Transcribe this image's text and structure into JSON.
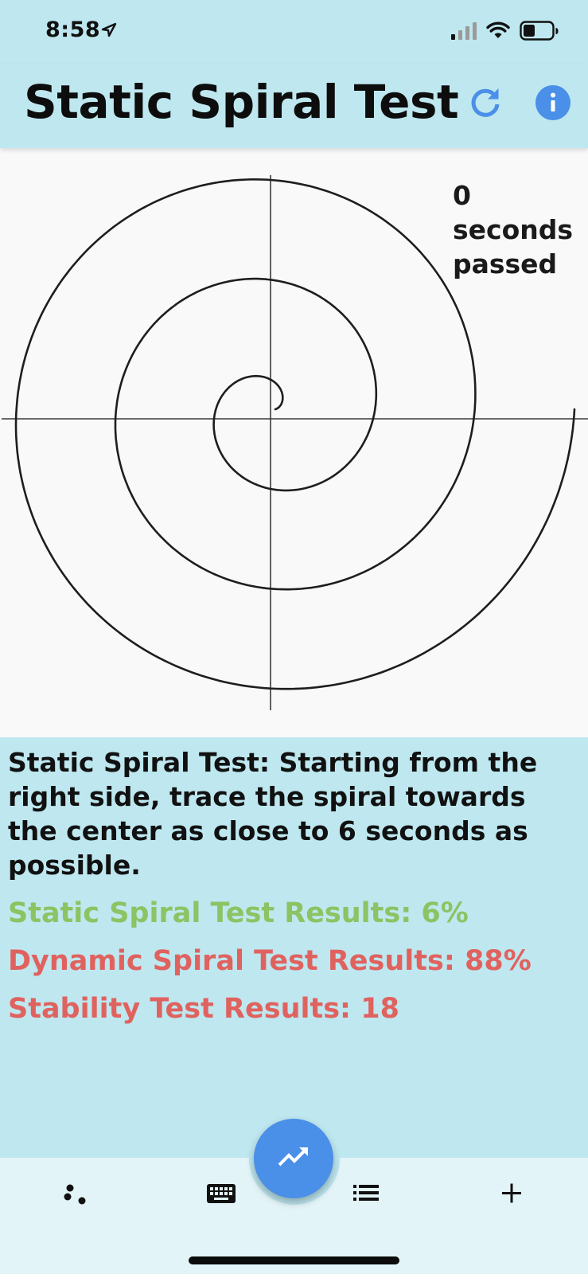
{
  "status_bar": {
    "time": "8:58",
    "location_icon": "location-arrow-icon",
    "signal_icon": "cellular-signal-icon",
    "wifi_icon": "wifi-icon",
    "battery_icon": "battery-icon"
  },
  "app_bar": {
    "title": "Static Spiral Test",
    "refresh_icon": "refresh-icon",
    "info_icon": "info-icon"
  },
  "spiral": {
    "timer_value": "0",
    "timer_label": "seconds passed"
  },
  "instructions": "Static Spiral Test: Starting from the right side, trace the spiral towards the center as close to 6 seconds as possible.",
  "results": {
    "static": "Static Spiral Test Results: 6%",
    "dynamic": "Dynamic Spiral Test Results: 88%",
    "stability": "Stability Test Results: 18"
  },
  "bottom_nav": {
    "items": [
      {
        "icon": "dots-icon"
      },
      {
        "icon": "keyboard-icon"
      },
      {
        "icon": "list-icon"
      },
      {
        "icon": "add-icon"
      }
    ],
    "fab_icon": "trending-up-icon"
  },
  "colors": {
    "background": "#bee7ef",
    "accent": "#4a8fe8",
    "good": "#8cc363",
    "bad": "#e0625f"
  }
}
